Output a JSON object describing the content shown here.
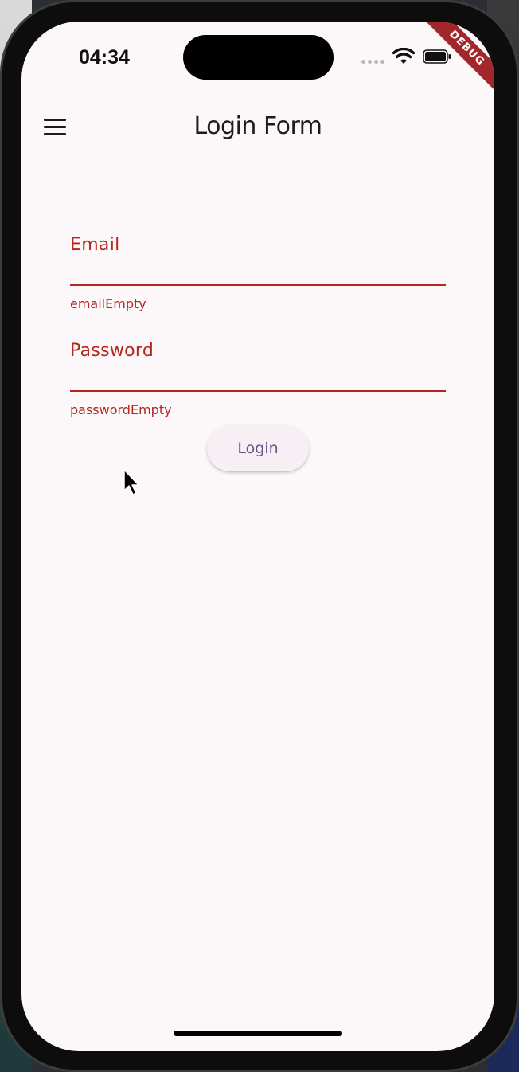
{
  "status_bar": {
    "time": "04:34",
    "wifi_icon": "wifi-icon",
    "battery_icon": "battery-icon"
  },
  "debug_banner": "DEBUG",
  "app_bar": {
    "menu_icon": "hamburger-menu-icon",
    "title": "Login Form"
  },
  "form": {
    "email": {
      "label": "Email",
      "error": "emailEmpty"
    },
    "password": {
      "label": "Password",
      "error": "passwordEmpty"
    },
    "login_button": "Login"
  },
  "colors": {
    "error": "#b3261e",
    "background": "#fcf8fa",
    "button_text": "#65558f",
    "button_bg": "#f6f0f5",
    "debug_ribbon": "#a3262a"
  }
}
